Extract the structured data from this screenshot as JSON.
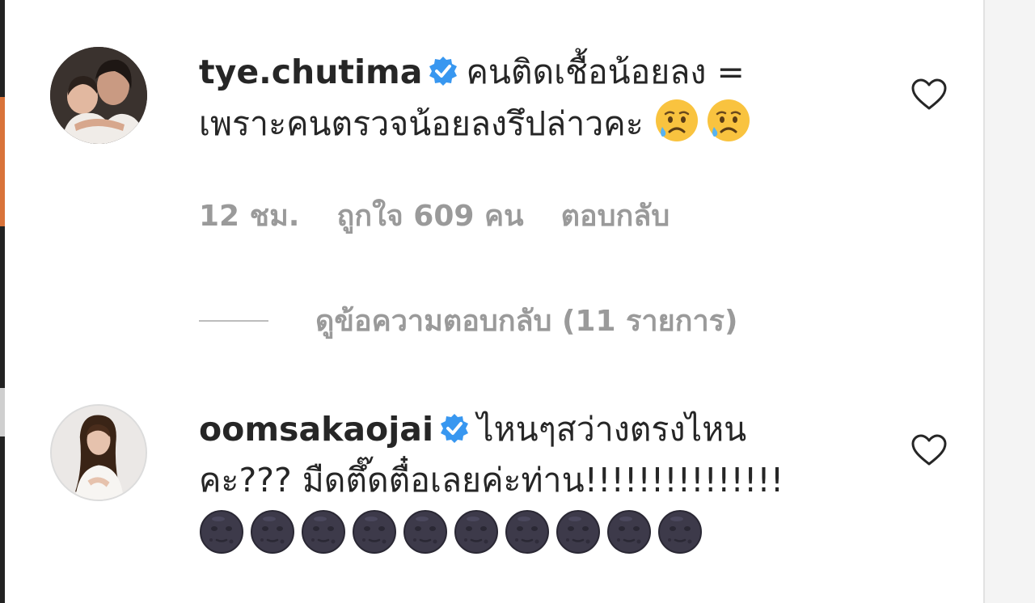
{
  "comments": [
    {
      "username": "tye.chutima",
      "verified": true,
      "line1": "คนติดเชื้อน้อยลง =",
      "line2": "เพราะคนตรวจน้อยลงรึปล่าวคะ",
      "emojis": [
        "sad-sweat-face",
        "sad-sweat-face"
      ],
      "time": "12 ชม.",
      "likes": "ถูกใจ 609 คน",
      "reply": "ตอบกลับ",
      "view_replies": "ดูข้อความตอบกลับ (11 รายการ)"
    },
    {
      "username": "oomsakaojai",
      "verified": true,
      "line1": "ไหนๆสว่างตรงไหน",
      "line2": "คะ??? มืดตึ๊ดตื๋อเลยค่ะท่าน!!!!!!!!!!!!!!!",
      "emoji_row": [
        "new-moon-face",
        "new-moon-face",
        "new-moon-face",
        "new-moon-face",
        "new-moon-face",
        "new-moon-face",
        "new-moon-face",
        "new-moon-face",
        "new-moon-face",
        "new-moon-face"
      ]
    }
  ],
  "icons": {
    "verified": "verified-badge-icon",
    "like": "heart-icon"
  },
  "colors": {
    "verified_blue": "#3897f0",
    "meta_gray": "#9a9a9a",
    "text": "#262626"
  }
}
